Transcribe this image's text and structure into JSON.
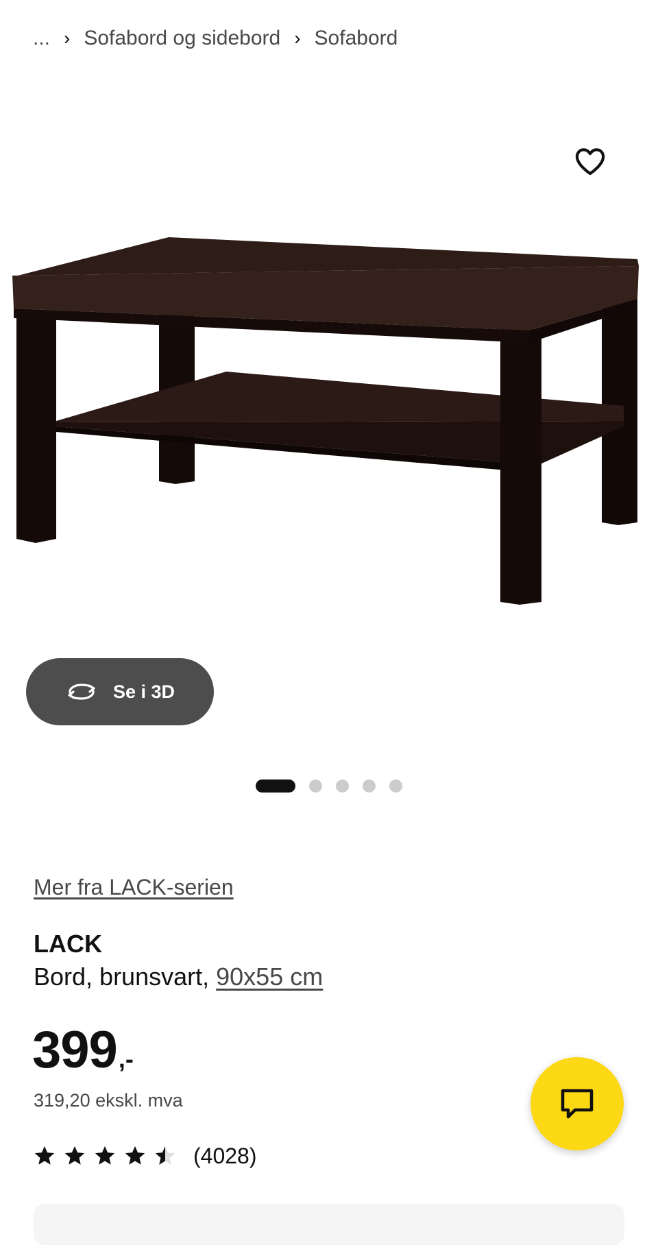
{
  "breadcrumb": {
    "ellipsis": "...",
    "items": [
      "Sofabord og sidebord",
      "Sofabord"
    ]
  },
  "icons": {
    "favorite": "heart-icon",
    "rotate": "rotate-3d-icon",
    "chat": "chat-bubble-icon",
    "chevron": "chevron-right-icon"
  },
  "gallery": {
    "view_3d_label": "Se i 3D",
    "dot_count": 5,
    "active_index": 0
  },
  "product": {
    "series_link": "Mer fra LACK-serien",
    "name": "LACK",
    "desc_prefix": "Bord, brunsvart, ",
    "size_link": "90x55 cm",
    "price_int": "399",
    "price_dec": ",-",
    "price_ex_vat": "319,20 ekskl. mva",
    "rating_value": 4.5,
    "rating_max": 5,
    "review_count": "(4028)"
  },
  "colors": {
    "accent_yellow": "#fcd815",
    "button_dark": "#4d4d4d",
    "table_brown": "#2a1714"
  }
}
